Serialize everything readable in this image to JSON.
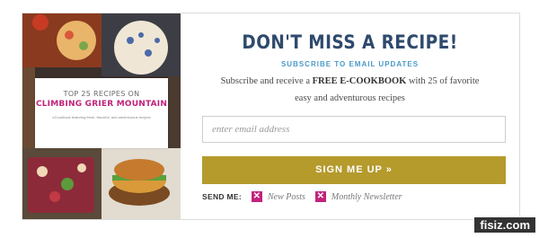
{
  "cover": {
    "top_line": "TOP 25 RECIPES ON",
    "title": "CLIMBING GRIER MOUNTAIN",
    "description": "eCookbook featuring fresh, flavorful, and adventurous recipes",
    "accent_color": "#c2237c"
  },
  "main": {
    "headline": "DON'T MISS A RECIPE!",
    "subheading": "SUBSCRIBE TO EMAIL UPDATES",
    "description_before": "Subscribe and receive a ",
    "description_bold": "FREE E-COOKBOOK",
    "description_after": " with 25 of favorite easy and adventurous recipes",
    "headline_color": "#2f4a6d",
    "subheading_color": "#4b9ac9"
  },
  "form": {
    "email_placeholder": "enter email address",
    "submit_label": "SIGN ME UP »",
    "submit_color": "#b59a2c",
    "send_me_label": "SEND ME:",
    "options": [
      {
        "label": "New Posts",
        "checked": true
      },
      {
        "label": "Monthly Newsletter",
        "checked": true
      }
    ],
    "check_glyph": "✕"
  },
  "watermark": "fisiz.com"
}
